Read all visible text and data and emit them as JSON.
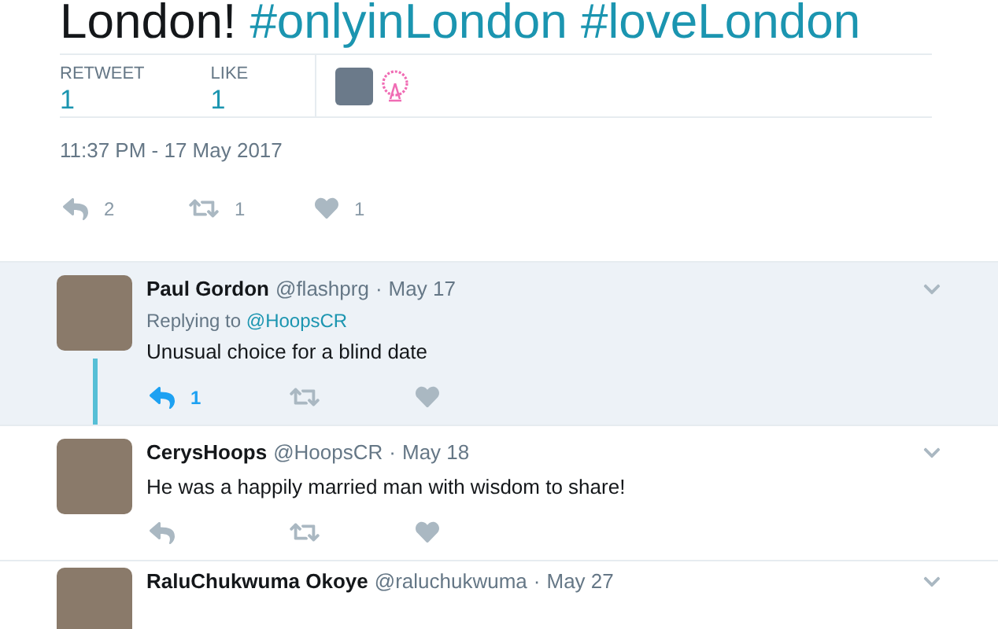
{
  "tweet": {
    "text": "London!",
    "hashtags": [
      "#onlyinLondon",
      "#loveLondon"
    ],
    "stats": [
      {
        "label": "RETWEET",
        "value": "1"
      },
      {
        "label": "LIKE",
        "value": "1"
      }
    ],
    "timestamp": "11:37 PM - 17 May 2017",
    "actions": [
      {
        "kind": "reply",
        "count": "2",
        "active": false
      },
      {
        "kind": "retweet",
        "count": "1",
        "active": false
      },
      {
        "kind": "like",
        "count": "1",
        "active": false
      }
    ]
  },
  "replies": [
    {
      "name": "Paul Gordon",
      "handle": "@flashprg",
      "separator": "·",
      "date": "May 17",
      "highlighted": true,
      "thread_line": true,
      "replying_label": "Replying to",
      "replying_to": "@HoopsCR",
      "text": "Unusual choice for a blind date",
      "actions": [
        {
          "kind": "reply",
          "count": "1",
          "active": true
        },
        {
          "kind": "retweet",
          "active": false
        },
        {
          "kind": "like",
          "active": false
        }
      ]
    },
    {
      "name": "CerysHoops",
      "handle": "@HoopsCR",
      "separator": "·",
      "date": "May 18",
      "highlighted": false,
      "thread_line": false,
      "text": "He was a happily married man with wisdom to share!",
      "actions": [
        {
          "kind": "reply",
          "active": false
        },
        {
          "kind": "retweet",
          "active": false
        },
        {
          "kind": "like",
          "active": false
        }
      ]
    },
    {
      "name": "RaluChukwuma Okoye",
      "handle": "@raluchukwuma",
      "separator": "·",
      "date": "May 27",
      "highlighted": false,
      "thread_line": false
    }
  ]
}
